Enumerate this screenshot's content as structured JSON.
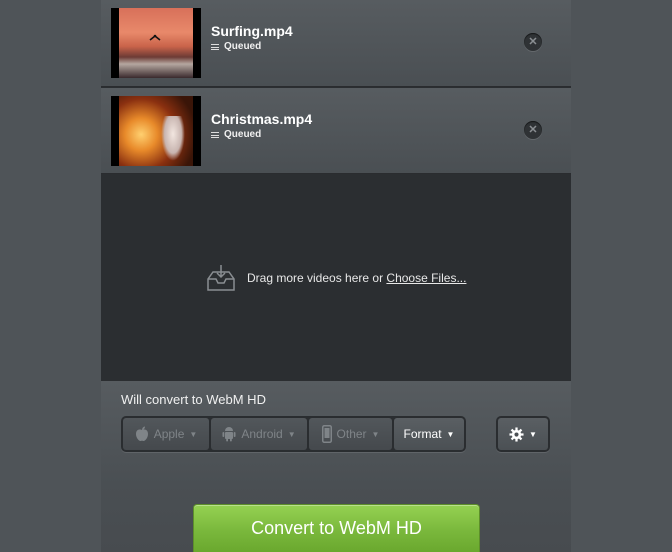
{
  "files": [
    {
      "name": "Surfing.mp4",
      "status": "Queued",
      "thumbnail": "surfing-thumbnail"
    },
    {
      "name": "Christmas.mp4",
      "status": "Queued",
      "thumbnail": "christmas-thumbnail"
    }
  ],
  "drop_zone": {
    "text": "Drag more videos here or ",
    "link": "Choose Files..."
  },
  "convert_target": "Will convert to WebM HD",
  "presets": {
    "apple": "Apple",
    "android": "Android",
    "other": "Other",
    "format": "Format"
  },
  "convert_button": "Convert to WebM HD",
  "colors": {
    "accent_green": "#7ab83c",
    "panel": "#2b2e31",
    "background": "#4f5458"
  }
}
